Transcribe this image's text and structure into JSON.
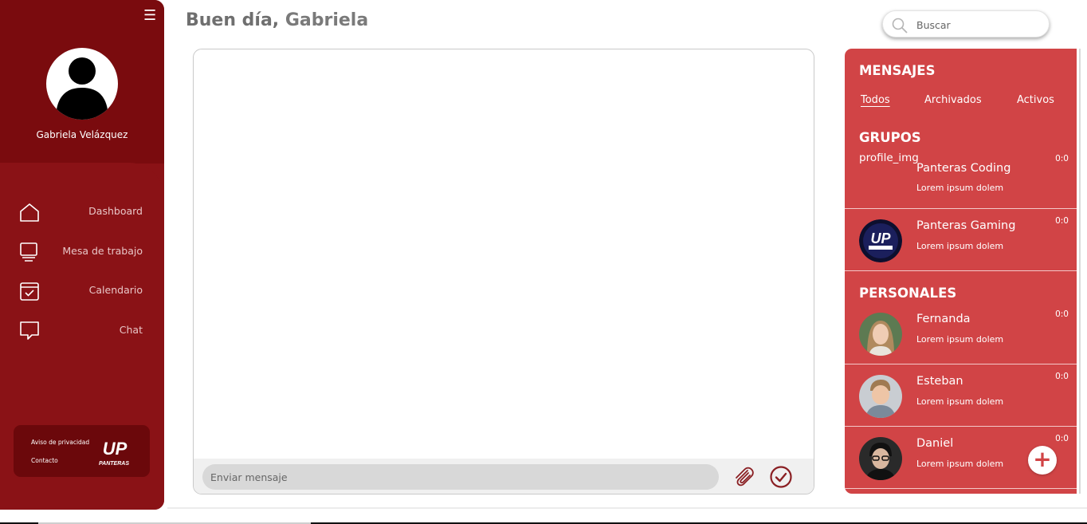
{
  "colors": {
    "sidebar": "#8a1216",
    "sidebar_top": "#7a0b0e",
    "accent_panel": "#d14446",
    "text_white": "#ffffff"
  },
  "sidebar": {
    "menu_icon": "hamburger-icon",
    "user_name": "Gabriela Velázquez",
    "nav": [
      {
        "label": "Dashboard",
        "icon": "home-icon"
      },
      {
        "label": "Mesa de trabajo",
        "icon": "monitor-icon"
      },
      {
        "label": "Calendario",
        "icon": "calendar-check-icon"
      },
      {
        "label": "Chat",
        "icon": "chat-bubble-icon"
      }
    ],
    "footer": {
      "privacy": "Aviso de privacidad",
      "contact": "Contacto",
      "logo_text": "UP",
      "logo_sub": "PANTERAS"
    }
  },
  "header": {
    "greeting_bold": "Buen día,",
    "greeting_name": " Gabriela",
    "search_placeholder": "Buscar"
  },
  "chat": {
    "input_placeholder": "Enviar mensaje",
    "attach_icon": "paperclip-icon",
    "send_icon": "check-circle-icon"
  },
  "messages": {
    "title": "MENSAJES",
    "tabs": [
      "Todos",
      "Archivados",
      "Activos"
    ],
    "active_tab": "Todos",
    "groups_title": "GRUPOS",
    "groups": [
      {
        "name": "Panteras Coding",
        "preview": "Lorem ipsum dolem",
        "time": "0:0",
        "avatar_alt": "profile_img"
      },
      {
        "name": "Panteras Gaming",
        "preview": "Lorem ipsum dolem",
        "time": "0:0"
      }
    ],
    "personal_title": "PERSONALES",
    "personal": [
      {
        "name": "Fernanda",
        "preview": "Lorem ipsum dolem",
        "time": "0:0"
      },
      {
        "name": "Esteban",
        "preview": "Lorem ipsum dolem",
        "time": "0:0"
      },
      {
        "name": "Daniel",
        "preview": "Lorem ipsum dolem",
        "time": "0:0"
      }
    ],
    "add_label": "+"
  }
}
